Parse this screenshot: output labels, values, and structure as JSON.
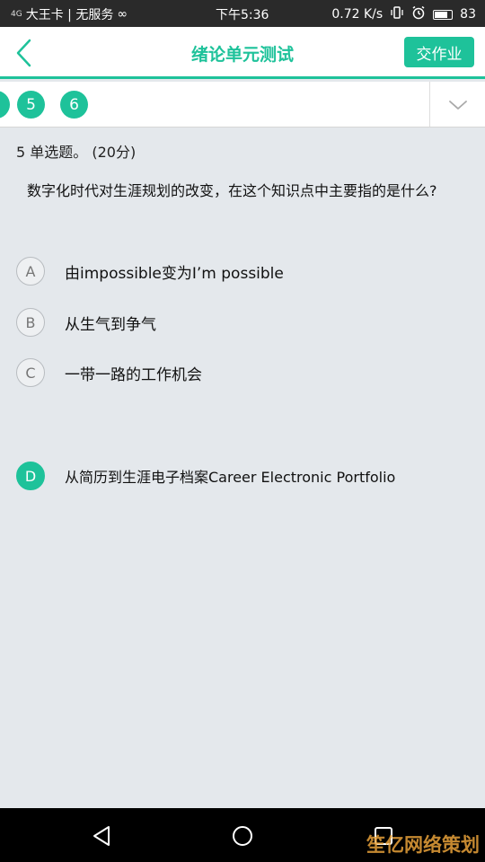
{
  "status_bar": {
    "signal": "4G",
    "carrier": "大王卡 | 无服务",
    "infinity": "∞",
    "time": "下午5:36",
    "speed": "0.72 K/s",
    "battery": "83",
    "battery_level_percent": 83
  },
  "header": {
    "title": "绪论单元测试",
    "submit_label": "交作业"
  },
  "question_nav": {
    "items": [
      "5",
      "6"
    ],
    "current": "5"
  },
  "question": {
    "type_label": "5  单选题。 (20分)",
    "text": "数字化时代对生涯规划的改变，在这个知识点中主要指的是什么?",
    "options": [
      {
        "letter": "A",
        "text": "由impossible变为I’m possible",
        "selected": false
      },
      {
        "letter": "B",
        "text": "从生气到争气",
        "selected": false
      },
      {
        "letter": "C",
        "text": "一带一路的工作机会",
        "selected": false
      },
      {
        "letter": "D",
        "text": "从简历到生涯电子档案Career Electronic Portfolio",
        "selected": true
      }
    ]
  },
  "colors": {
    "accent": "#1ec29a",
    "background": "#e4e8ec"
  },
  "watermark": "笙亿网络策划"
}
